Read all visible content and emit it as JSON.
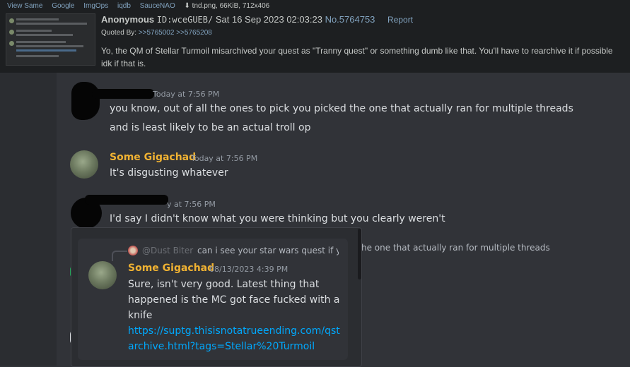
{
  "post": {
    "toplinks": [
      "View Same",
      "Google",
      "ImgOps",
      "iqdb",
      "SauceNAO"
    ],
    "file_info": "⬇ tnd.png, 66KiB, 712x406",
    "name": "Anonymous",
    "id": "ID:wceGUEB/",
    "date": "Sat 16 Sep 2023 02:03:23",
    "number": "No.5764753",
    "report": "Report",
    "quoted_by_label": "Quoted By:",
    "quoted_by": [
      ">>5765002",
      ">>5765208"
    ],
    "body": "Yo, the QM of Stellar Turmoil misarchived your quest as \"Tranny quest\" or something dumb like that. You'll have to rearchive it if possible idk if that is."
  },
  "messages": [
    {
      "timestamp": "Today at 7:56 PM",
      "lines": [
        "you know, out of all the ones to pick you picked the one that actually ran for multiple threads",
        "and is least likely to be an actual troll op"
      ]
    },
    {
      "username": "Some Gigachad",
      "timestamp": "Today at 7:56 PM",
      "lines": [
        "It's disgusting whatever"
      ]
    },
    {
      "timestamp": "y at 7:56 PM",
      "lines": [
        "I'd say I didn't know what you were thinking but you clearly weren't"
      ]
    }
  ],
  "embed": {
    "reply_mention": "@Dust Biter",
    "reply_preview": "can i see your star wars quest if yo",
    "background_text": "he one that actually ran for multiple threads",
    "username": "Some Gigachad",
    "timestamp": "08/13/2023 4:39 PM",
    "body": "Sure, isn't very good. Latest thing that happened is the MC got face fucked with a knife",
    "link": "https://suptg.thisisnotatrueending.com/qstarchive.html?tags=Stellar%20Turmoil"
  },
  "colors": {
    "username": "#f0b232",
    "link": "#00a8fc",
    "post_link": "#81a2be"
  }
}
